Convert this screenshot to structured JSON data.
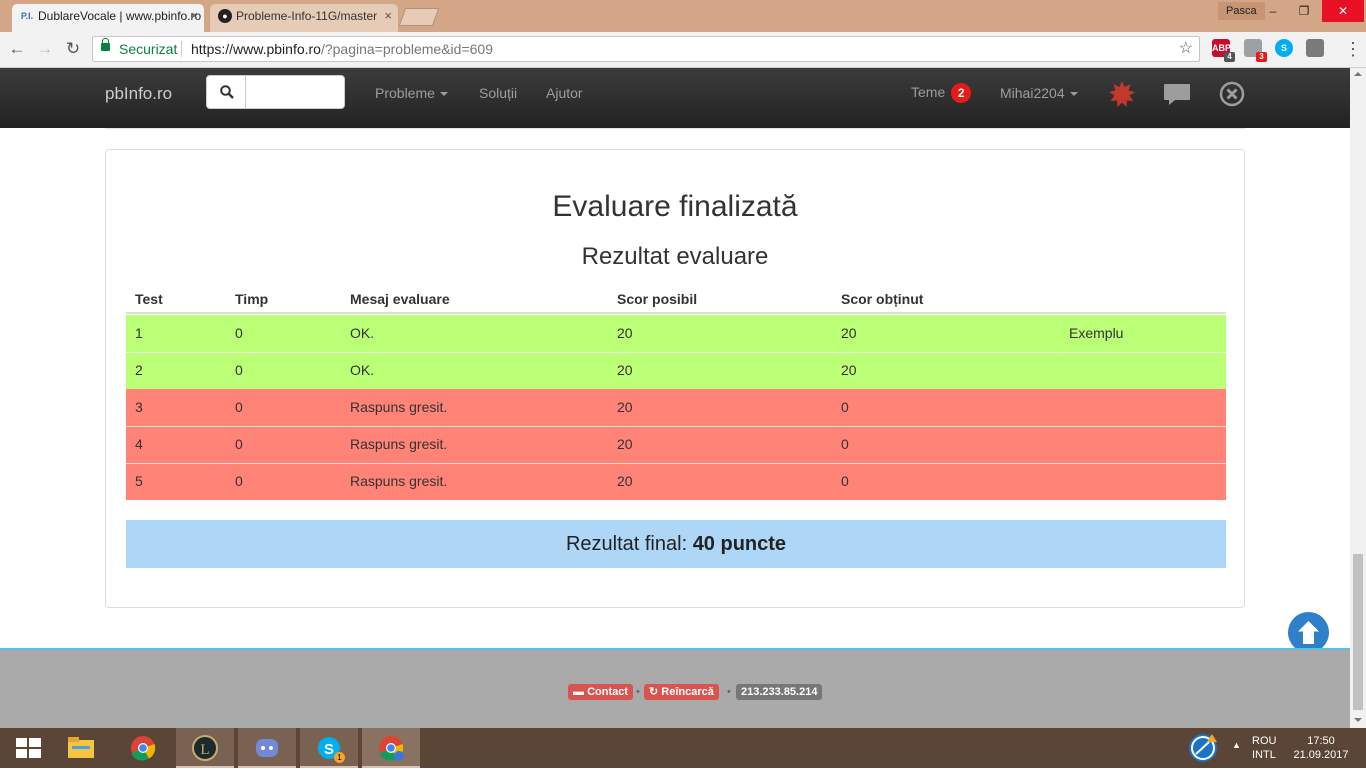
{
  "browser": {
    "tabs": [
      {
        "title": "DublareVocale | www.pbinfo.ro",
        "favicon": "pbinfo-favicon-icon",
        "favicon_text": "P.I."
      },
      {
        "title": "Probleme-Info-11G/master",
        "favicon": "github-icon"
      }
    ],
    "user": "Pasca",
    "window_controls": {
      "minimize": "–",
      "maximize": "❐",
      "close": "✕"
    },
    "secure_label": "Securizat",
    "url_host": "https://www.pbinfo.ro",
    "url_path": "/?pagina=probleme&id=609",
    "extensions": [
      {
        "name": "adblock-plus-icon",
        "label": "ABP",
        "badge": "4",
        "color": "#c70d2c"
      },
      {
        "name": "translate-extension-icon",
        "label": "",
        "badge": "3",
        "color": "#9aa0a6"
      },
      {
        "name": "skype-extension-icon",
        "label": "S",
        "badge": "",
        "color": "#00aff0"
      },
      {
        "name": "save-extension-icon",
        "label": "",
        "badge": "",
        "color": "#7a7a7a"
      }
    ]
  },
  "navbar": {
    "brand": "pbInfo.ro",
    "search_placeholder": "",
    "links": {
      "probleme": "Probleme",
      "solutii": "Soluții",
      "ajutor": "Ajutor"
    },
    "teme_label": "Teme",
    "teme_count": "2",
    "username": "Mihai2204"
  },
  "main": {
    "title": "Evaluare finalizată",
    "subtitle": "Rezultat evaluare",
    "table": {
      "headers": [
        "Test",
        "Timp",
        "Mesaj evaluare",
        "Scor posibil",
        "Scor obținut",
        ""
      ],
      "rows": [
        {
          "test": "1",
          "timp": "0",
          "mesaj": "OK.",
          "posibil": "20",
          "obtinut": "20",
          "extra": "Exemplu",
          "status": "ok"
        },
        {
          "test": "2",
          "timp": "0",
          "mesaj": "OK.",
          "posibil": "20",
          "obtinut": "20",
          "extra": "",
          "status": "ok"
        },
        {
          "test": "3",
          "timp": "0",
          "mesaj": "Raspuns gresit.",
          "posibil": "20",
          "obtinut": "0",
          "extra": "",
          "status": "bad"
        },
        {
          "test": "4",
          "timp": "0",
          "mesaj": "Raspuns gresit.",
          "posibil": "20",
          "obtinut": "0",
          "extra": "",
          "status": "bad"
        },
        {
          "test": "5",
          "timp": "0",
          "mesaj": "Raspuns gresit.",
          "posibil": "20",
          "obtinut": "0",
          "extra": "",
          "status": "bad"
        }
      ]
    },
    "final_label": "Rezultat final:",
    "final_value": "40 puncte"
  },
  "footer": {
    "contact": "Contact",
    "reincarca": "Reîncarcă",
    "ip": "213.233.85.214",
    "dot": "•"
  },
  "taskbar": {
    "lang_top": "ROU",
    "lang_bottom": "INTL",
    "time": "17:50",
    "date": "21.09.2017",
    "skype_badge": "1"
  },
  "colors": {
    "ok_row": "#bbff77",
    "bad_row": "#ff8377",
    "final_bg": "#aed6f7",
    "navbar_bg": "#222222",
    "badge_red": "#e41b17"
  }
}
